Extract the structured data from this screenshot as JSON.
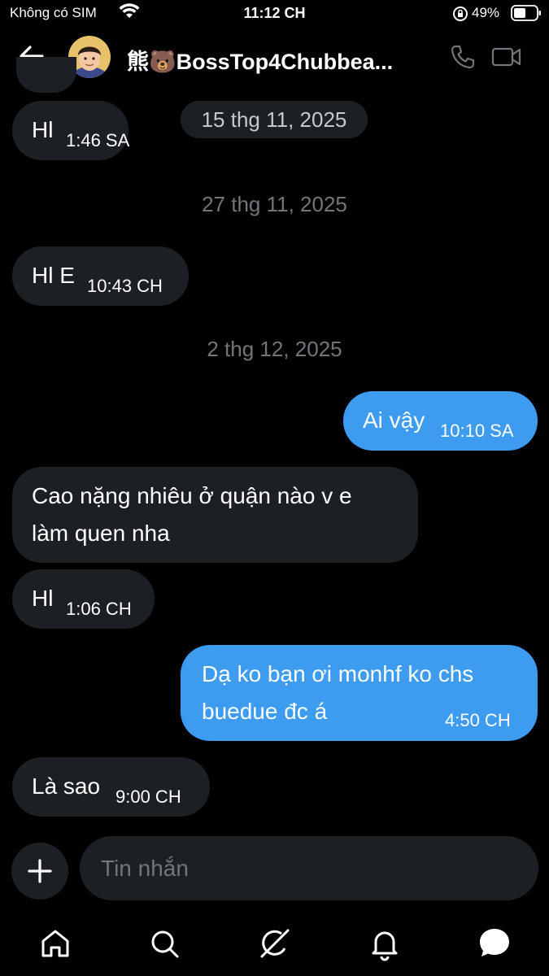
{
  "status_bar": {
    "carrier": "Không có SIM",
    "time": "11:12 CH",
    "battery": "49%"
  },
  "header": {
    "contact_name": "熊🐻BossTop4Chubbea...",
    "icons": [
      "back-arrow-icon",
      "phone-icon",
      "video-icon"
    ]
  },
  "messages": [
    {
      "dir": "in",
      "text": "Hl",
      "time": "1:46 SA"
    },
    {
      "type": "date",
      "text": "15 thg 11, 2025"
    },
    {
      "type": "date",
      "text": "27 thg 11, 2025"
    },
    {
      "dir": "in",
      "text": "Hl E",
      "time": "10:43 CH"
    },
    {
      "type": "date",
      "text": "2 thg 12, 2025"
    },
    {
      "dir": "out",
      "text": "Ai vậy",
      "time": "10:10 SA"
    },
    {
      "dir": "in",
      "line1": "Cao nặng nhiêu ở quận nào v e",
      "line2": "làm quen nha"
    },
    {
      "dir": "in",
      "text": "Hl",
      "time": "1:06 CH"
    },
    {
      "dir": "out",
      "line1": "Dạ ko bạn ơi monhf ko chs",
      "line2": "buedue đc á",
      "time": "4:50 CH"
    },
    {
      "dir": "in",
      "text": "Là sao",
      "time": "9:00 CH"
    }
  ],
  "composer": {
    "placeholder": "Tin nhắn"
  },
  "nav": [
    "home-icon",
    "search-icon",
    "grok-icon",
    "notifications-icon",
    "messages-icon"
  ],
  "colors": {
    "background": "#000000",
    "incoming_bubble": "#1c1f23",
    "outgoing_bubble": "#3d9bf0",
    "muted_text": "#71767b"
  }
}
